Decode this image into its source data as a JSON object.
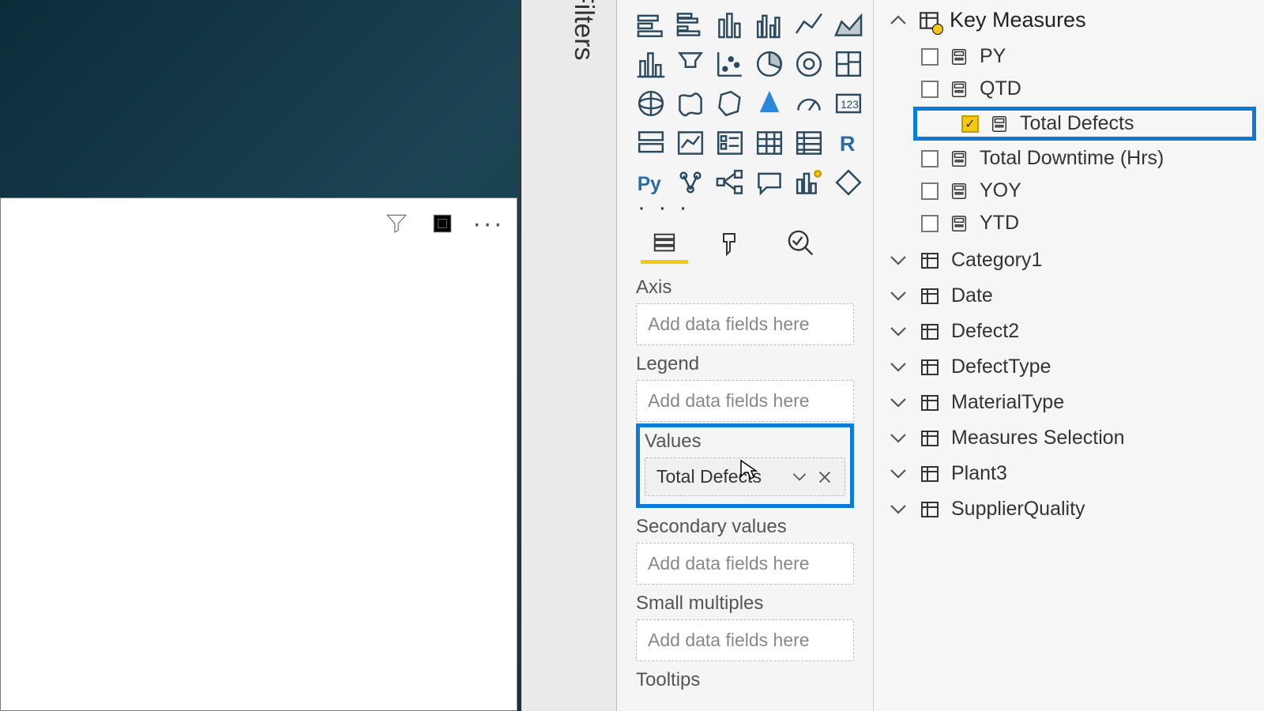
{
  "filters_label": "Filters",
  "drop_placeholder": "Add data fields here",
  "wells": {
    "axis": "Axis",
    "legend": "Legend",
    "values": "Values",
    "values_item": "Total Defects",
    "secondary": "Secondary values",
    "small_multiples": "Small multiples",
    "tooltips": "Tooltips"
  },
  "km": {
    "title": "Key Measures",
    "items": [
      {
        "label": "PY",
        "checked": false
      },
      {
        "label": "QTD",
        "checked": false
      },
      {
        "label": "Total Defects",
        "checked": true,
        "highlight": true
      },
      {
        "label": "Total Downtime (Hrs)",
        "checked": false
      },
      {
        "label": "YOY",
        "checked": false
      },
      {
        "label": "YTD",
        "checked": false
      }
    ]
  },
  "tables": [
    "Category1",
    "Date",
    "Defect2",
    "DefectType",
    "MaterialType",
    "Measures Selection",
    "Plant3",
    "SupplierQuality"
  ]
}
